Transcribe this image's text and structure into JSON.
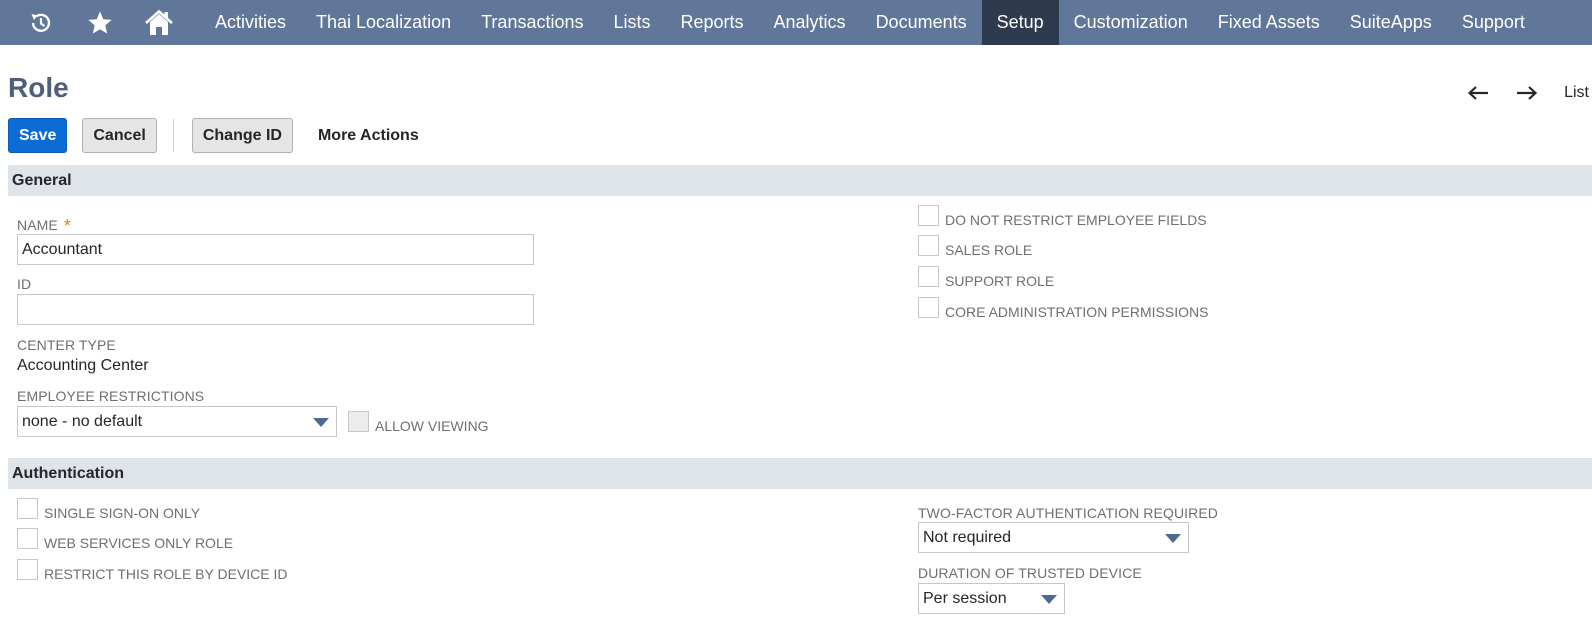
{
  "nav": {
    "icons": [
      "recent-records-icon",
      "star-icon",
      "home-icon"
    ],
    "items": [
      {
        "label": "Activities",
        "active": false
      },
      {
        "label": "Thai Localization",
        "active": false
      },
      {
        "label": "Transactions",
        "active": false
      },
      {
        "label": "Lists",
        "active": false
      },
      {
        "label": "Reports",
        "active": false
      },
      {
        "label": "Analytics",
        "active": false
      },
      {
        "label": "Documents",
        "active": false
      },
      {
        "label": "Setup",
        "active": true
      },
      {
        "label": "Customization",
        "active": false
      },
      {
        "label": "Fixed Assets",
        "active": false
      },
      {
        "label": "SuiteApps",
        "active": false
      },
      {
        "label": "Support",
        "active": false
      }
    ]
  },
  "page": {
    "title": "Role",
    "pager": {
      "prev_icon": "arrow-left-icon",
      "next_icon": "arrow-right-icon",
      "list_label": "List"
    }
  },
  "buttons": {
    "save": "Save",
    "cancel": "Cancel",
    "change_id": "Change ID",
    "more_actions": "More Actions"
  },
  "general": {
    "heading": "General",
    "name": {
      "label": "NAME",
      "required_mark": "*",
      "value": "Accountant"
    },
    "id": {
      "label": "ID",
      "value": ""
    },
    "center_type": {
      "label": "CENTER TYPE",
      "value": "Accounting Center"
    },
    "employee_restrictions": {
      "label": "EMPLOYEE RESTRICTIONS",
      "value": "none - no default"
    },
    "allow_viewing": {
      "label": "ALLOW VIEWING",
      "checked": false,
      "disabled": true
    },
    "checkboxes": [
      {
        "label": "DO NOT RESTRICT EMPLOYEE FIELDS",
        "checked": false
      },
      {
        "label": "SALES ROLE",
        "checked": false
      },
      {
        "label": "SUPPORT ROLE",
        "checked": false
      },
      {
        "label": "CORE ADMINISTRATION PERMISSIONS",
        "checked": false
      }
    ]
  },
  "authentication": {
    "heading": "Authentication",
    "checkboxes": [
      {
        "label": "SINGLE SIGN-ON ONLY",
        "checked": false
      },
      {
        "label": "WEB SERVICES ONLY ROLE",
        "checked": false
      },
      {
        "label": "RESTRICT THIS ROLE BY DEVICE ID",
        "checked": false
      }
    ],
    "two_factor": {
      "label": "TWO-FACTOR AUTHENTICATION REQUIRED",
      "value": "Not required"
    },
    "trusted_device": {
      "label": "DURATION OF TRUSTED DEVICE",
      "value": "Per session"
    }
  },
  "colors": {
    "nav_bg": "#607799",
    "nav_active": "#2e3b4f",
    "primary_button": "#0c6cd6",
    "section_bg": "#dfe4eb",
    "title": "#4d5f79",
    "required": "#d38a00"
  }
}
